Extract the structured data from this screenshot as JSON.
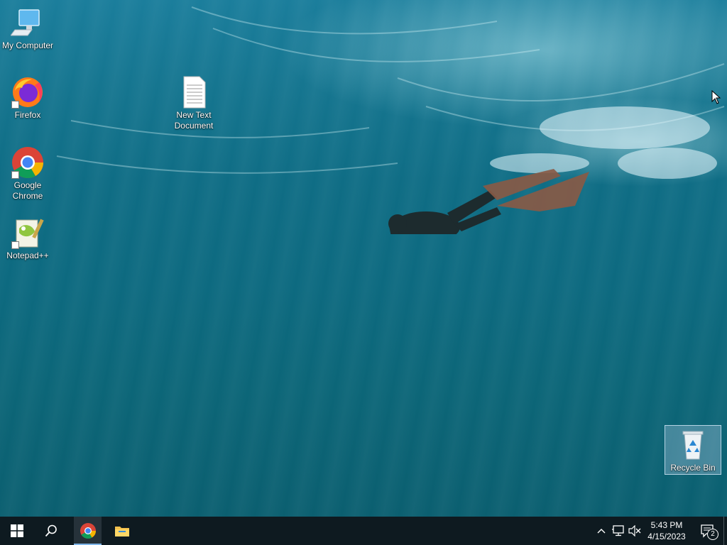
{
  "desktop": {
    "icons": [
      {
        "label": "My Computer",
        "icon": "computer-icon"
      },
      {
        "label": "Firefox",
        "icon": "firefox-icon"
      },
      {
        "label": "Google Chrome",
        "icon": "chrome-icon"
      },
      {
        "label": "Notepad++",
        "icon": "notepadpp-icon"
      },
      {
        "label": "New Text Document",
        "icon": "text-document-icon"
      },
      {
        "label": "Recycle Bin",
        "icon": "recycle-bin-icon"
      }
    ]
  },
  "taskbar": {
    "start": "windows-logo-icon",
    "search": "search-icon",
    "pinned": [
      {
        "name": "Google Chrome",
        "icon": "chrome-icon",
        "active": true
      },
      {
        "name": "File Explorer",
        "icon": "folder-icon",
        "active": false
      }
    ],
    "tray": {
      "icons": [
        "chevron-up-icon",
        "network-icon",
        "speaker-muted-icon"
      ],
      "time": "5:43 PM",
      "date": "4/15/2023",
      "notification_count": "2"
    }
  },
  "colors": {
    "taskbar_bg": "#0e1a20",
    "accent": "#7fb6ea"
  }
}
